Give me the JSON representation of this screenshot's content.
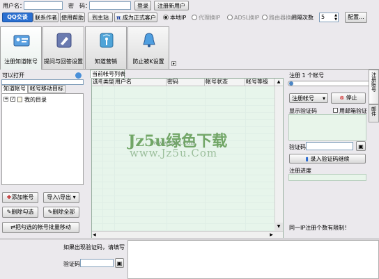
{
  "topbar": {
    "username_label": "用户名：",
    "password_label": "密　码：",
    "login_btn": "登录",
    "register_btn": "注册新用户",
    "qq_badge": "QQ交谈",
    "contact_author": "联系作者",
    "help_btn": "使用帮助",
    "home_btn": "到主站",
    "pro_btn": "成为正式客户",
    "radio_local": "本地IP",
    "radio_proxy": "代理换IP",
    "radio_adsl": "ADSL换IP",
    "radio_router": "路由器换IP",
    "interval_label": "间隔次数",
    "interval_value": "5",
    "config_btn": "配置..."
  },
  "tabs": [
    {
      "label": "注册知道帐号",
      "icon": "id-card-icon",
      "active": true
    },
    {
      "label": "提问与回答设置",
      "icon": "edit-pen-icon",
      "active": false
    },
    {
      "label": "知道营销",
      "icon": "antenna-icon",
      "active": false
    },
    {
      "label": "防止被K设置",
      "icon": "bell-icon",
      "active": false
    }
  ],
  "left": {
    "can_open": "可以打开",
    "subtab_accounts": "知道帐号",
    "subtab_move": "帐号移动目标",
    "tree_root": "我的目录",
    "add_account": "添加帐号",
    "import_export": "导入\\导出",
    "delete_checked": "删除勾选",
    "delete_all": "删除全部",
    "batch_move": "把勾选的帐号批量移动"
  },
  "center": {
    "list_tab": "当前帐号列表",
    "columns": [
      "选中",
      "类型",
      "用户名",
      "密码",
      "帐号状态",
      "帐号等级"
    ]
  },
  "watermark": {
    "main": "Jz5u绿色下载",
    "url": "www.Jz5u.Com",
    "url_small": "www.Jz5u.Com"
  },
  "right": {
    "register_count": "注册 1 个帐号",
    "account_type": "注册帐号",
    "stop_btn": "停止",
    "show_captcha": "显示验证码",
    "use_mailbox": "用邮箱验证",
    "captcha_label": "验证码",
    "enter_captcha_btn": "录入验证码继续",
    "progress_label": "注册进度",
    "limit_text": "同一IP注册个数有限制！",
    "side_tab_1": "注册账号",
    "side_tab_2": "邮件"
  },
  "bottom": {
    "captcha_hint": "如果出现验证码，请填写",
    "captcha_label": "验证码"
  }
}
